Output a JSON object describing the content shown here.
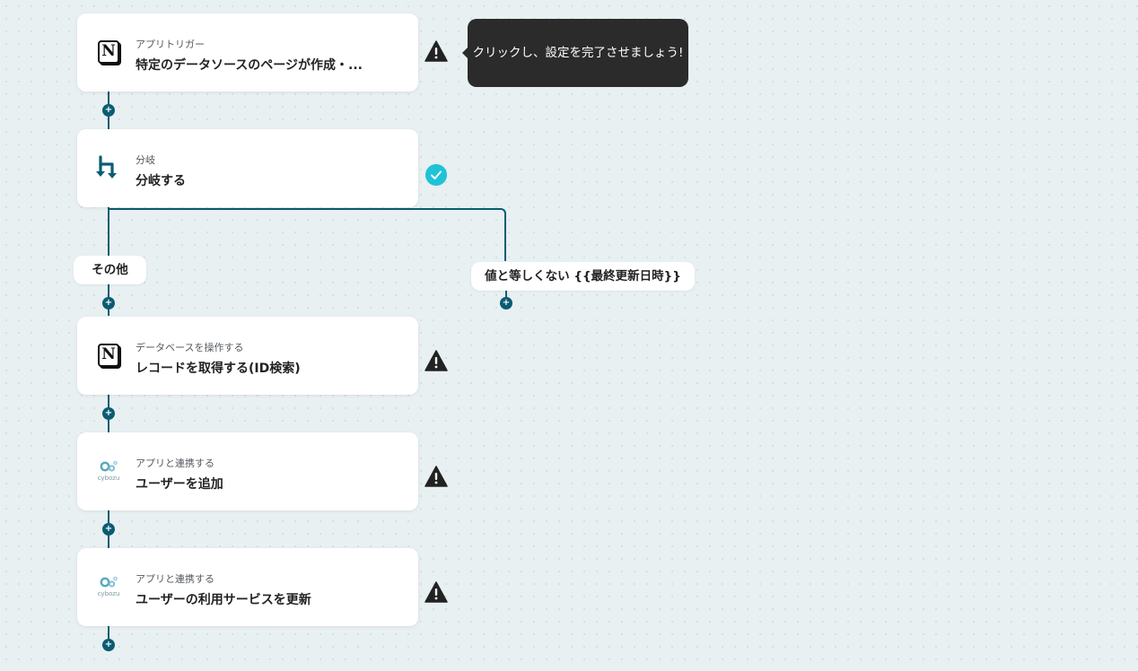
{
  "tooltip": {
    "text": "クリックし、設定を完了させましょう!"
  },
  "flow": {
    "steps": [
      {
        "id": "trigger",
        "icon": "notion-icon",
        "subtitle": "アプリトリガー",
        "title": "特定のデータソースのページが作成・...",
        "status": "warning"
      },
      {
        "id": "branch",
        "icon": "branch-icon",
        "subtitle": "分岐",
        "title": "分岐する",
        "status": "complete"
      },
      {
        "id": "notion-db",
        "icon": "notion-icon",
        "subtitle": "データベースを操作する",
        "title": "レコードを取得する(ID検索)",
        "status": "warning"
      },
      {
        "id": "cybozu-add",
        "icon": "cybozu-icon",
        "subtitle": "アプリと連携する",
        "title": "ユーザーを追加",
        "status": "warning"
      },
      {
        "id": "cybozu-update",
        "icon": "cybozu-icon",
        "subtitle": "アプリと連携する",
        "title": "ユーザーの利用サービスを更新",
        "status": "warning"
      }
    ],
    "branches": {
      "left_label": "その他",
      "right_label": "値と等しくない {{最終更新日時}}"
    }
  },
  "logos": {
    "cybozu_text": "cybozu",
    "notion_letter": "N"
  },
  "colors": {
    "connector": "#0b5c73",
    "complete": "#1fc3d6",
    "warning": "#222222",
    "tooltip_bg": "#2b2b2b"
  }
}
